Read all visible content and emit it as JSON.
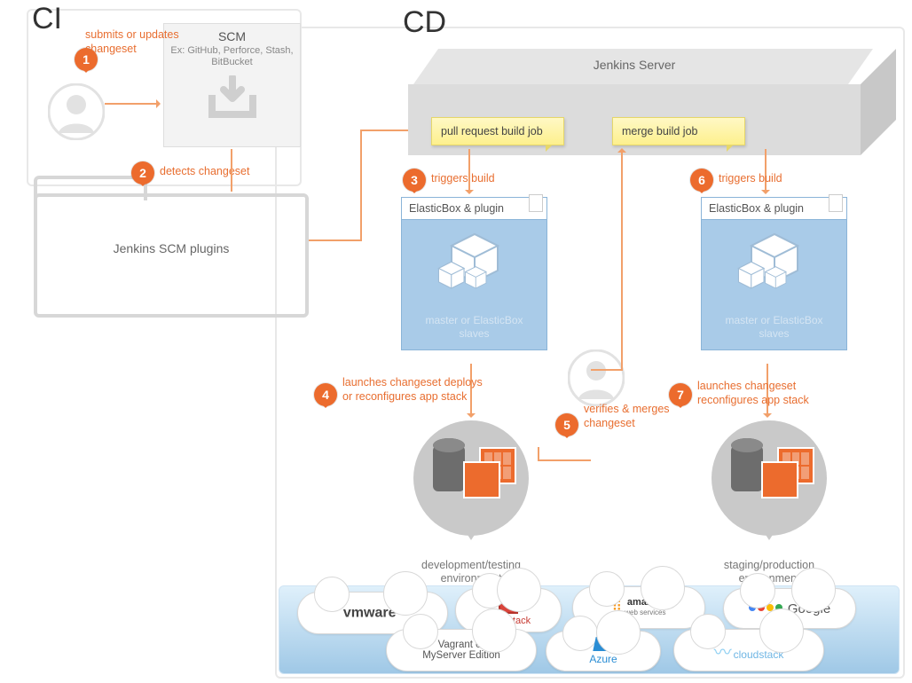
{
  "headings": {
    "ci": "CI",
    "cd": "CD"
  },
  "scm": {
    "title": "SCM",
    "subtitle": "Ex: GitHub, Perforce, Stash, BitBucket"
  },
  "plugins_box": "Jenkins SCM plugins",
  "server_label": "Jenkins Server",
  "notes": {
    "pull_request": "pull request build job",
    "merge": "merge build job"
  },
  "elasticbox": {
    "title": "ElasticBox & plugin",
    "caption": "master or\nElasticBox slaves"
  },
  "env": {
    "dev": "development/testing environment",
    "prod": "staging/production environment"
  },
  "steps": {
    "s1": {
      "n": "1",
      "text": "submits or updates changeset"
    },
    "s2": {
      "n": "2",
      "text": "detects changeset"
    },
    "s3": {
      "n": "3",
      "text": "triggers build"
    },
    "s4": {
      "n": "4",
      "text": "launches changeset deploys or reconfigures app stack"
    },
    "s5": {
      "n": "5",
      "text": "verifies & merges changeset"
    },
    "s6": {
      "n": "6",
      "text": "triggers build"
    },
    "s7": {
      "n": "7",
      "text": "launches changeset reconfigures app stack"
    }
  },
  "clouds": {
    "vmware": "vmware",
    "openstack": "openstack",
    "amazon": "amazon",
    "amazon_sub": "web services",
    "google": "Google",
    "vagrant": "Vagrant or\nMyServer Edition",
    "azure": "Azure",
    "cloudstack": "cloudstack"
  }
}
